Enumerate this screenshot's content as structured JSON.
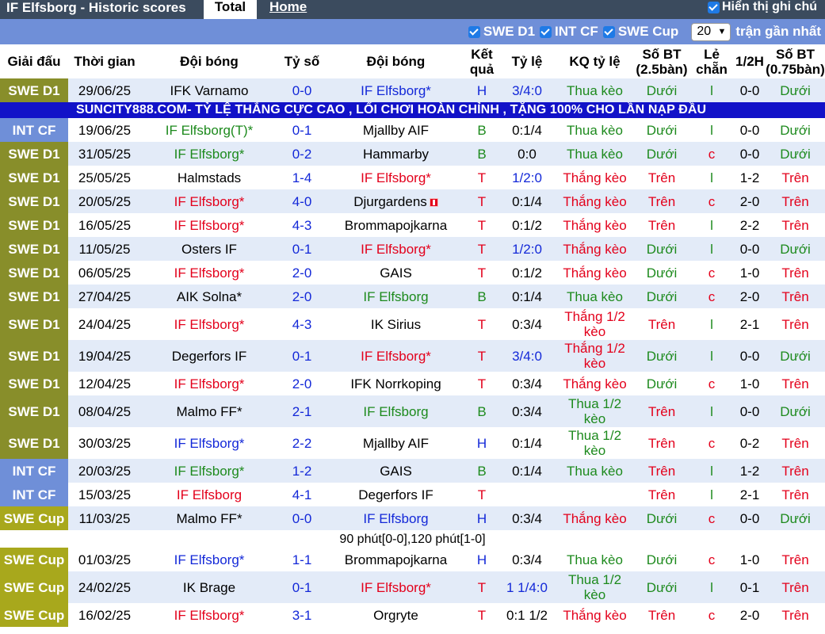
{
  "header": {
    "title": "IF Elfsborg - Historic scores",
    "tab_total": "Total",
    "tab_home": "Home",
    "show_notes": "Hiển thị ghi chú"
  },
  "filters": {
    "swe_d1": "SWE D1",
    "int_cf": "INT CF",
    "swe_cup": "SWE Cup",
    "count_value": "20",
    "recent_label": "trận gần nhất"
  },
  "columns": {
    "league": "Giải đấu",
    "time": "Thời gian",
    "team1": "Đội bóng",
    "score": "Tỷ số",
    "team2": "Đội bóng",
    "result": "Kết quả",
    "odds": "Tỷ lệ",
    "odds_result": "KQ tỷ lệ",
    "goals25": "Số BT (2.5bàn)",
    "oddeven": "Lẻ chẵn",
    "half": "1/2H",
    "goals075": "Số BT (0.75bàn)"
  },
  "banner": "SUNCITY888.COM- TỶ LỆ THẮNG CỰC CAO , LỐI CHƠI HOÀN CHỈNH , TẶNG 100% CHO LẦN NẠP ĐẦU",
  "colors": {
    "swe_d1": "#888e2a",
    "int_cf": "#6f8fd8",
    "swe_cup": "#a8a81c",
    "red": "#e3001b",
    "green": "#1d8a1d",
    "blue": "#1328d8",
    "topbar": "#3b4b5e",
    "banner": "#1212c8"
  },
  "matches": [
    {
      "league": "SWE D1",
      "date": "29/06/25",
      "team1": "IFK Varnamo",
      "team1_color": "black",
      "score": "0-0",
      "score_color": "blue",
      "team2": "IF Elfsborg*",
      "team2_color": "blue",
      "result": "H",
      "result_color": "blue",
      "odds": "3/4:0",
      "odds_color": "blue",
      "kq": "Thua kèo",
      "kq_color": "green",
      "bt": "Dưới",
      "bt_color": "green",
      "le": "l",
      "le_color": "green",
      "half": "0-0",
      "bt2": "Dưới",
      "bt2_color": "green"
    },
    {
      "league": "INT CF",
      "date": "19/06/25",
      "team1": "IF Elfsborg(T)*",
      "team1_color": "green",
      "score": "0-1",
      "score_color": "blue",
      "team2": "Mjallby AIF",
      "team2_color": "black",
      "result": "B",
      "result_color": "green",
      "odds": "0:1/4",
      "odds_color": "black",
      "kq": "Thua kèo",
      "kq_color": "green",
      "bt": "Dưới",
      "bt_color": "green",
      "le": "l",
      "le_color": "green",
      "half": "0-0",
      "bt2": "Dưới",
      "bt2_color": "green"
    },
    {
      "league": "SWE D1",
      "date": "31/05/25",
      "team1": "IF Elfsborg*",
      "team1_color": "green",
      "score": "0-2",
      "score_color": "blue",
      "team2": "Hammarby",
      "team2_color": "black",
      "result": "B",
      "result_color": "green",
      "odds": "0:0",
      "odds_color": "black",
      "kq": "Thua kèo",
      "kq_color": "green",
      "bt": "Dưới",
      "bt_color": "green",
      "le": "c",
      "le_color": "red",
      "half": "0-0",
      "bt2": "Dưới",
      "bt2_color": "green"
    },
    {
      "league": "SWE D1",
      "date": "25/05/25",
      "team1": "Halmstads",
      "team1_color": "black",
      "score": "1-4",
      "score_color": "blue",
      "team2": "IF Elfsborg*",
      "team2_color": "red",
      "result": "T",
      "result_color": "red",
      "odds": "1/2:0",
      "odds_color": "blue",
      "kq": "Thắng kèo",
      "kq_color": "red",
      "bt": "Trên",
      "bt_color": "red",
      "le": "l",
      "le_color": "green",
      "half": "1-2",
      "bt2": "Trên",
      "bt2_color": "red"
    },
    {
      "league": "SWE D1",
      "date": "20/05/25",
      "team1": "IF Elfsborg*",
      "team1_color": "red",
      "score": "4-0",
      "score_color": "blue",
      "team2": "Djurgardens",
      "team2_color": "black",
      "flag": true,
      "result": "T",
      "result_color": "red",
      "odds": "0:1/4",
      "odds_color": "black",
      "kq": "Thắng kèo",
      "kq_color": "red",
      "bt": "Trên",
      "bt_color": "red",
      "le": "c",
      "le_color": "red",
      "half": "2-0",
      "bt2": "Trên",
      "bt2_color": "red"
    },
    {
      "league": "SWE D1",
      "date": "16/05/25",
      "team1": "IF Elfsborg*",
      "team1_color": "red",
      "score": "4-3",
      "score_color": "blue",
      "team2": "Brommapojkarna",
      "team2_color": "black",
      "result": "T",
      "result_color": "red",
      "odds": "0:1/2",
      "odds_color": "black",
      "kq": "Thắng kèo",
      "kq_color": "red",
      "bt": "Trên",
      "bt_color": "red",
      "le": "l",
      "le_color": "green",
      "half": "2-2",
      "bt2": "Trên",
      "bt2_color": "red"
    },
    {
      "league": "SWE D1",
      "date": "11/05/25",
      "team1": "Osters IF",
      "team1_color": "black",
      "score": "0-1",
      "score_color": "blue",
      "team2": "IF Elfsborg*",
      "team2_color": "red",
      "result": "T",
      "result_color": "red",
      "odds": "1/2:0",
      "odds_color": "blue",
      "kq": "Thắng kèo",
      "kq_color": "red",
      "bt": "Dưới",
      "bt_color": "green",
      "le": "l",
      "le_color": "green",
      "half": "0-0",
      "bt2": "Dưới",
      "bt2_color": "green"
    },
    {
      "league": "SWE D1",
      "date": "06/05/25",
      "team1": "IF Elfsborg*",
      "team1_color": "red",
      "score": "2-0",
      "score_color": "blue",
      "team2": "GAIS",
      "team2_color": "black",
      "result": "T",
      "result_color": "red",
      "odds": "0:1/2",
      "odds_color": "black",
      "kq": "Thắng kèo",
      "kq_color": "red",
      "bt": "Dưới",
      "bt_color": "green",
      "le": "c",
      "le_color": "red",
      "half": "1-0",
      "bt2": "Trên",
      "bt2_color": "red"
    },
    {
      "league": "SWE D1",
      "date": "27/04/25",
      "team1": "AIK Solna*",
      "team1_color": "black",
      "score": "2-0",
      "score_color": "blue",
      "team2": "IF Elfsborg",
      "team2_color": "green",
      "result": "B",
      "result_color": "green",
      "odds": "0:1/4",
      "odds_color": "black",
      "kq": "Thua kèo",
      "kq_color": "green",
      "bt": "Dưới",
      "bt_color": "green",
      "le": "c",
      "le_color": "red",
      "half": "2-0",
      "bt2": "Trên",
      "bt2_color": "red"
    },
    {
      "league": "SWE D1",
      "date": "24/04/25",
      "tall": true,
      "team1": "IF Elfsborg*",
      "team1_color": "red",
      "score": "4-3",
      "score_color": "blue",
      "team2": "IK Sirius",
      "team2_color": "black",
      "result": "T",
      "result_color": "red",
      "odds": "0:3/4",
      "odds_color": "black",
      "kq": "Thắng 1/2 kèo",
      "kq_color": "red",
      "bt": "Trên",
      "bt_color": "red",
      "le": "l",
      "le_color": "green",
      "half": "2-1",
      "bt2": "Trên",
      "bt2_color": "red"
    },
    {
      "league": "SWE D1",
      "date": "19/04/25",
      "tall": true,
      "team1": "Degerfors IF",
      "team1_color": "black",
      "score": "0-1",
      "score_color": "blue",
      "team2": "IF Elfsborg*",
      "team2_color": "red",
      "result": "T",
      "result_color": "red",
      "odds": "3/4:0",
      "odds_color": "blue",
      "kq": "Thắng 1/2 kèo",
      "kq_color": "red",
      "bt": "Dưới",
      "bt_color": "green",
      "le": "l",
      "le_color": "green",
      "half": "0-0",
      "bt2": "Dưới",
      "bt2_color": "green"
    },
    {
      "league": "SWE D1",
      "date": "12/04/25",
      "team1": "IF Elfsborg*",
      "team1_color": "red",
      "score": "2-0",
      "score_color": "blue",
      "team2": "IFK Norrkoping",
      "team2_color": "black",
      "result": "T",
      "result_color": "red",
      "odds": "0:3/4",
      "odds_color": "black",
      "kq": "Thắng kèo",
      "kq_color": "red",
      "bt": "Dưới",
      "bt_color": "green",
      "le": "c",
      "le_color": "red",
      "half": "1-0",
      "bt2": "Trên",
      "bt2_color": "red"
    },
    {
      "league": "SWE D1",
      "date": "08/04/25",
      "tall": true,
      "team1": "Malmo FF*",
      "team1_color": "black",
      "score": "2-1",
      "score_color": "blue",
      "team2": "IF Elfsborg",
      "team2_color": "green",
      "result": "B",
      "result_color": "green",
      "odds": "0:3/4",
      "odds_color": "black",
      "kq": "Thua 1/2 kèo",
      "kq_color": "green",
      "bt": "Trên",
      "bt_color": "red",
      "le": "l",
      "le_color": "green",
      "half": "0-0",
      "bt2": "Dưới",
      "bt2_color": "green"
    },
    {
      "league": "SWE D1",
      "date": "30/03/25",
      "tall": true,
      "team1": "IF Elfsborg*",
      "team1_color": "blue",
      "score": "2-2",
      "score_color": "blue",
      "team2": "Mjallby AIF",
      "team2_color": "black",
      "result": "H",
      "result_color": "blue",
      "odds": "0:1/4",
      "odds_color": "black",
      "kq": "Thua 1/2 kèo",
      "kq_color": "green",
      "bt": "Trên",
      "bt_color": "red",
      "le": "c",
      "le_color": "red",
      "half": "0-2",
      "bt2": "Trên",
      "bt2_color": "red"
    },
    {
      "league": "INT CF",
      "date": "20/03/25",
      "team1": "IF Elfsborg*",
      "team1_color": "green",
      "score": "1-2",
      "score_color": "blue",
      "team2": "GAIS",
      "team2_color": "black",
      "result": "B",
      "result_color": "green",
      "odds": "0:1/4",
      "odds_color": "black",
      "kq": "Thua kèo",
      "kq_color": "green",
      "bt": "Trên",
      "bt_color": "red",
      "le": "l",
      "le_color": "green",
      "half": "1-2",
      "bt2": "Trên",
      "bt2_color": "red"
    },
    {
      "league": "INT CF",
      "date": "15/03/25",
      "team1": "IF Elfsborg",
      "team1_color": "red",
      "score": "4-1",
      "score_color": "blue",
      "team2": "Degerfors IF",
      "team2_color": "black",
      "result": "T",
      "result_color": "red",
      "odds": "",
      "odds_color": "black",
      "kq": "",
      "kq_color": "red",
      "bt": "Trên",
      "bt_color": "red",
      "le": "l",
      "le_color": "green",
      "half": "2-1",
      "bt2": "Trên",
      "bt2_color": "red"
    },
    {
      "league": "SWE Cup",
      "date": "11/03/25",
      "team1": "Malmo FF*",
      "team1_color": "black",
      "score": "0-0",
      "score_color": "blue",
      "team2": "IF Elfsborg",
      "team2_color": "blue",
      "result": "H",
      "result_color": "blue",
      "odds": "0:3/4",
      "odds_color": "black",
      "kq": "Thắng kèo",
      "kq_color": "red",
      "bt": "Dưới",
      "bt_color": "green",
      "le": "c",
      "le_color": "red",
      "half": "0-0",
      "bt2": "Dưới",
      "bt2_color": "green",
      "note": "90 phút[0-0],120 phút[1-0]"
    },
    {
      "league": "SWE Cup",
      "date": "01/03/25",
      "team1": "IF Elfsborg*",
      "team1_color": "blue",
      "score": "1-1",
      "score_color": "blue",
      "team2": "Brommapojkarna",
      "team2_color": "black",
      "result": "H",
      "result_color": "blue",
      "odds": "0:3/4",
      "odds_color": "black",
      "kq": "Thua kèo",
      "kq_color": "green",
      "bt": "Dưới",
      "bt_color": "green",
      "le": "c",
      "le_color": "red",
      "half": "1-0",
      "bt2": "Trên",
      "bt2_color": "red"
    },
    {
      "league": "SWE Cup",
      "date": "24/02/25",
      "tall": true,
      "team1": "IK Brage",
      "team1_color": "black",
      "score": "0-1",
      "score_color": "blue",
      "team2": "IF Elfsborg*",
      "team2_color": "red",
      "result": "T",
      "result_color": "red",
      "odds": "1 1/4:0",
      "odds_color": "blue",
      "kq": "Thua 1/2 kèo",
      "kq_color": "green",
      "bt": "Dưới",
      "bt_color": "green",
      "le": "l",
      "le_color": "green",
      "half": "0-1",
      "bt2": "Trên",
      "bt2_color": "red"
    },
    {
      "league": "SWE Cup",
      "date": "16/02/25",
      "team1": "IF Elfsborg*",
      "team1_color": "red",
      "score": "3-1",
      "score_color": "blue",
      "team2": "Orgryte",
      "team2_color": "black",
      "result": "T",
      "result_color": "red",
      "odds": "0:1 1/2",
      "odds_color": "black",
      "kq": "Thắng kèo",
      "kq_color": "red",
      "bt": "Trên",
      "bt_color": "red",
      "le": "c",
      "le_color": "red",
      "half": "2-0",
      "bt2": "Trên",
      "bt2_color": "red"
    }
  ]
}
